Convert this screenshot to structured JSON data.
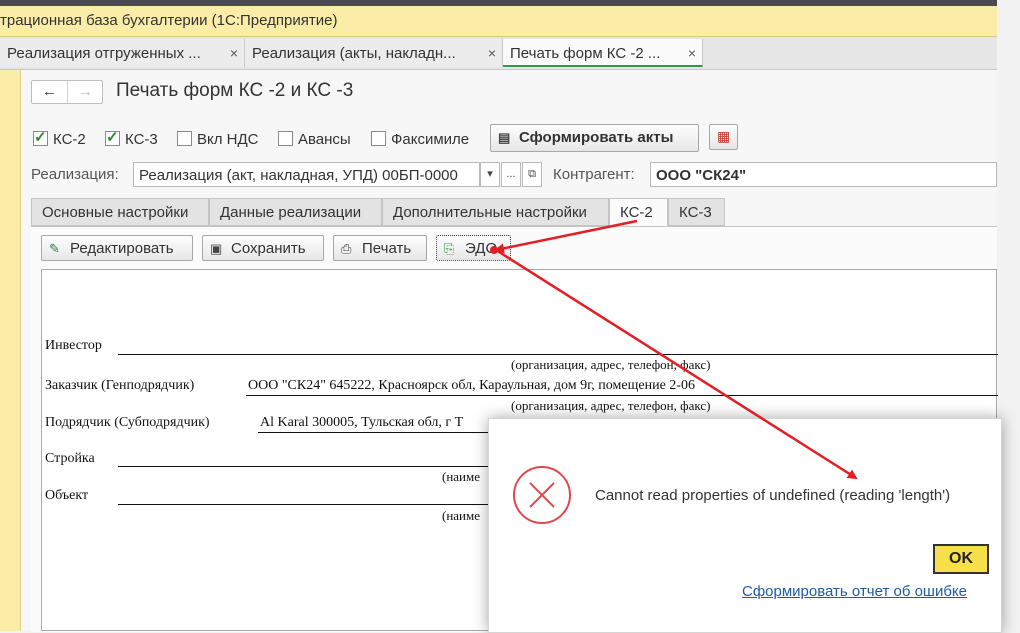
{
  "app": {
    "title": "трационная база бухгалтерии  (1С:Предприятие)"
  },
  "window_tabs": [
    {
      "label": "Реализация отгруженных ...",
      "close": "×"
    },
    {
      "label": "Реализация (акты, накладн...",
      "close": "×"
    },
    {
      "label": "Печать форм КС -2 ...",
      "close": "×"
    }
  ],
  "nav": {
    "back": "←",
    "forward": "→"
  },
  "page_title": "Печать форм КС -2 и КС -3",
  "checks": [
    {
      "label": "КС-2",
      "checked": true
    },
    {
      "label": "КС-3",
      "checked": true
    },
    {
      "label": "Вкл НДС",
      "checked": false
    },
    {
      "label": "Авансы",
      "checked": false
    },
    {
      "label": "Факсимиле",
      "checked": false
    }
  ],
  "form_button": "Сформировать акты",
  "realization": {
    "label": "Реализация:",
    "value": "Реализация (акт, накладная, УПД) 00БП-0000",
    "dropdown": "▾",
    "ellipsis": "...",
    "open": "⧉"
  },
  "counterparty": {
    "label": "Контрагент:",
    "value": "ООО \"СК24\""
  },
  "inner_tabs": [
    {
      "label": "Основные настройки"
    },
    {
      "label": "Данные реализации"
    },
    {
      "label": "Дополнительные настройки"
    },
    {
      "label": "КС-2"
    },
    {
      "label": "КС-3"
    }
  ],
  "toolbar": {
    "edit": "Редактировать",
    "save": "Сохранить",
    "print": "Печать",
    "edo": "ЭДО"
  },
  "document": {
    "investor": "Инвестор",
    "hint1": "(организация, адрес, телефон, факс)",
    "customer_label": "Заказчик (Генподрядчик)",
    "customer_value": "ООО \"СК24\" 645222, Красноярск обл, Караульная, дом 9г, помещение 2-06",
    "hint2": "(организация, адрес, телефон, факс)",
    "contractor_label": "Подрядчик (Субподрядчик)",
    "contractor_value": "Al Karal 300005, Тульская обл, г Т",
    "site_label": "Стройка",
    "hint3": "(наиме",
    "object_label": "Объект",
    "hint4": "(наиме"
  },
  "dialog": {
    "message": "Cannot read properties of undefined (reading 'length')",
    "ok": "OK",
    "report_link": "Сформировать отчет об ошибке"
  },
  "colors": {
    "title_bar": "#fbeda8",
    "error_red": "#e0484c",
    "ok_yellow": "#f7e04a",
    "link_blue": "#1a5ca8",
    "arrow_red": "#e31e24"
  }
}
